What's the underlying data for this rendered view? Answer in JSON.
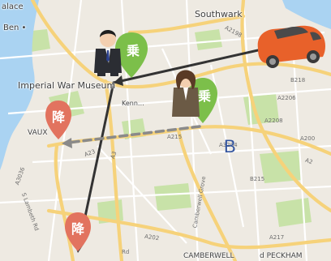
{
  "map": {
    "place_labels": [
      {
        "id": "palace",
        "text": "alace"
      },
      {
        "id": "southwark",
        "text": "Southwark"
      },
      {
        "id": "ben",
        "text": "Ben •"
      },
      {
        "id": "imperial-war-museum",
        "text": "Imperial War Museum"
      },
      {
        "id": "vauxhall",
        "text": "VAUX"
      },
      {
        "id": "camberwell",
        "text": "CAMBERWELL"
      },
      {
        "id": "peckham",
        "text": "d PECKHAM"
      },
      {
        "id": "kennington",
        "text": "Kenn…"
      }
    ],
    "road_labels": [
      {
        "id": "a2198",
        "text": "A2198"
      },
      {
        "id": "a3",
        "text": "A3"
      },
      {
        "id": "a2",
        "text": "A2"
      },
      {
        "id": "a202",
        "text": "A202"
      },
      {
        "id": "a23",
        "text": "A23"
      },
      {
        "id": "a3036",
        "text": "A3036"
      },
      {
        "id": "a2206",
        "text": "A2206"
      },
      {
        "id": "a2208",
        "text": "A2208"
      },
      {
        "id": "a215",
        "text": "A215"
      },
      {
        "id": "a217",
        "text": "A217"
      },
      {
        "id": "b218",
        "text": "B218"
      },
      {
        "id": "b215",
        "text": "B215"
      },
      {
        "id": "a200",
        "text": "A200"
      },
      {
        "id": "a3204",
        "text": "A3204"
      },
      {
        "id": "camberwell-grove",
        "text": "Camberwell Grove"
      },
      {
        "id": "s-lambeth-rd",
        "text": "S Lambeth Rd"
      },
      {
        "id": "rd",
        "text": "Rd"
      }
    ],
    "point_label": "B",
    "pins": [
      {
        "id": "pickup-1",
        "glyph": "乗",
        "color": "#7cbf4a"
      },
      {
        "id": "pickup-2",
        "glyph": "乗",
        "color": "#7cbf4a"
      },
      {
        "id": "dropoff-1",
        "glyph": "降",
        "color": "#e2735f"
      },
      {
        "id": "dropoff-2",
        "glyph": "降",
        "color": "#e2735f"
      }
    ],
    "vehicle": {
      "type": "car",
      "color": "#e8612a"
    },
    "passengers": [
      {
        "id": "passenger-man",
        "type": "businessman"
      },
      {
        "id": "passenger-woman",
        "type": "businesswoman"
      }
    ],
    "colors": {
      "land": "#eeeae2",
      "water": "#aad3f2",
      "park": "#c8e2a8",
      "major_road": "#f6d27a",
      "route": "#333333",
      "dashed_route": "#8a8a8a"
    }
  }
}
